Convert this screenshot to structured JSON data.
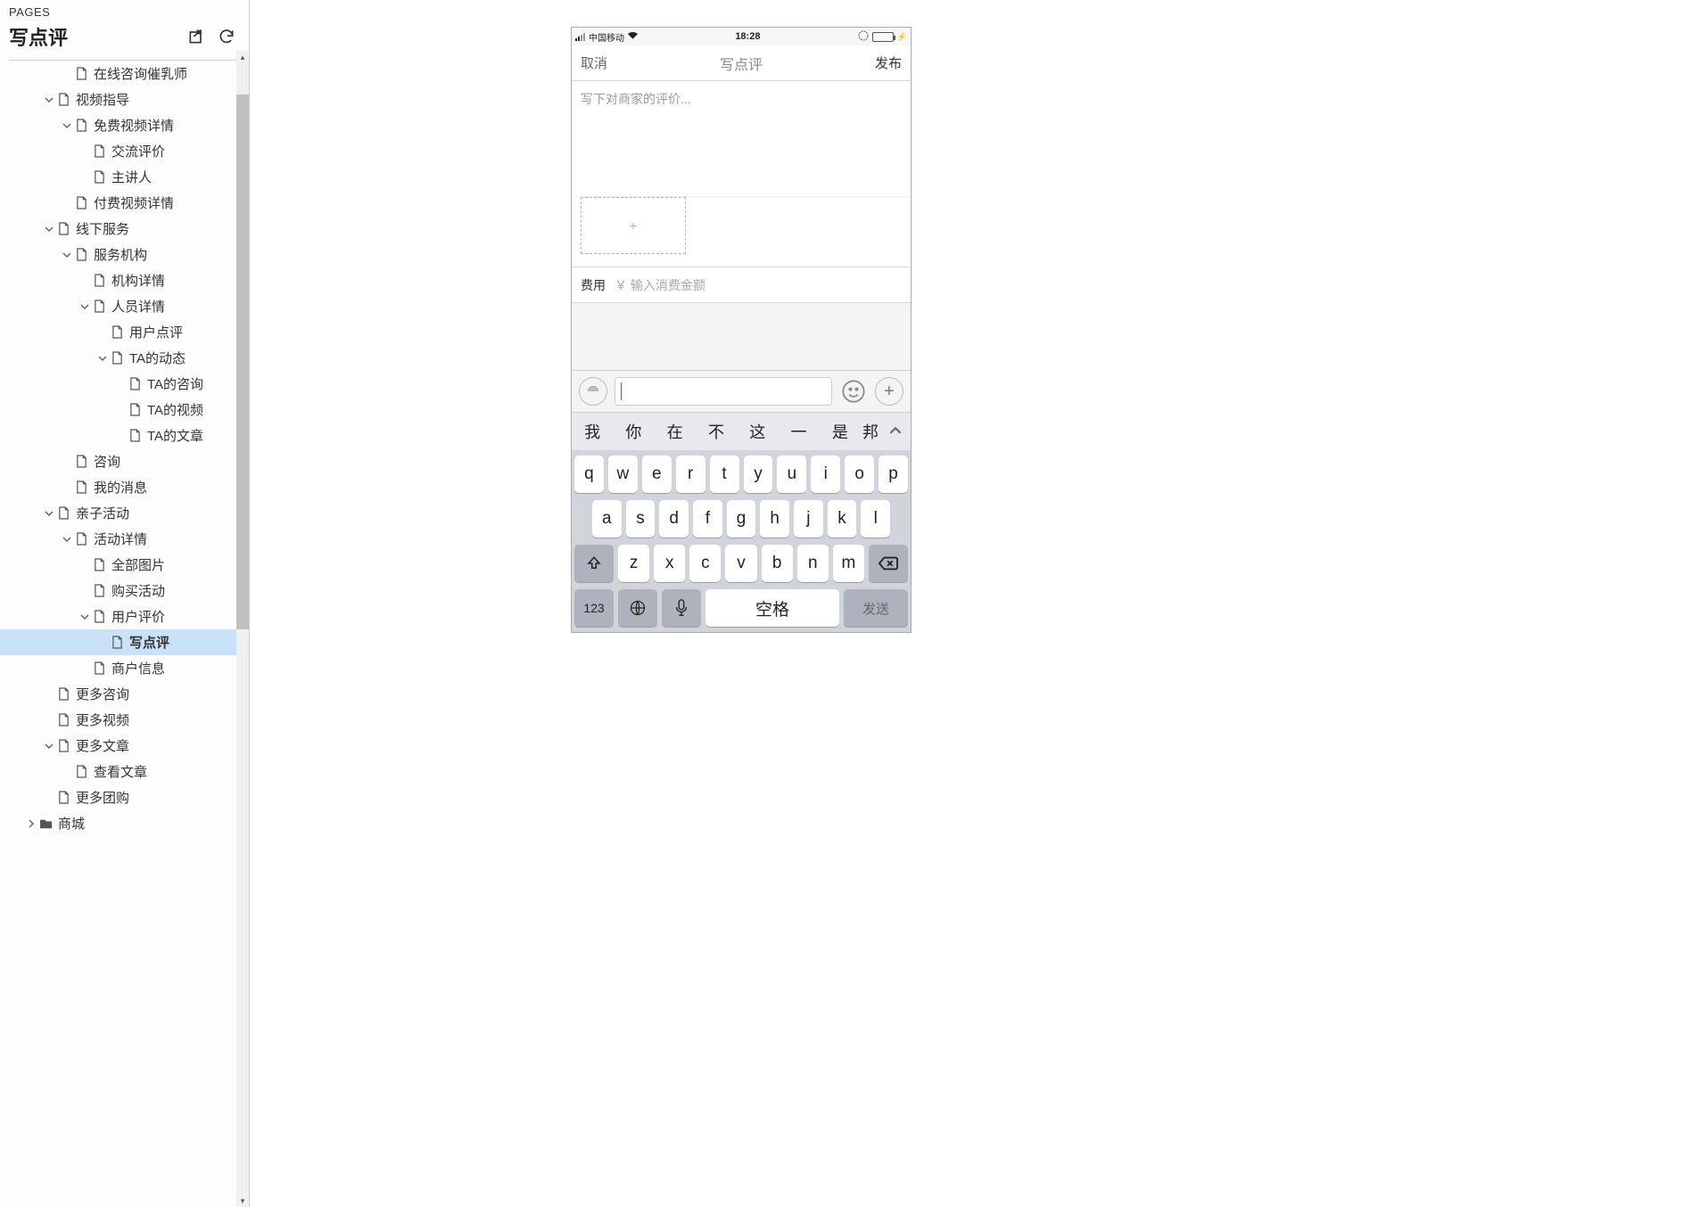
{
  "sidebar": {
    "pages_label": "PAGES",
    "current_page_title": "写点评",
    "tree": [
      {
        "depth": 3,
        "caret": "none",
        "icon": "doc",
        "label": "在线咨询催乳师"
      },
      {
        "depth": 2,
        "caret": "down",
        "icon": "doc",
        "label": "视频指导"
      },
      {
        "depth": 3,
        "caret": "down",
        "icon": "doc",
        "label": "免费视频详情"
      },
      {
        "depth": 4,
        "caret": "none",
        "icon": "doc",
        "label": "交流评价"
      },
      {
        "depth": 4,
        "caret": "none",
        "icon": "doc",
        "label": "主讲人"
      },
      {
        "depth": 3,
        "caret": "none",
        "icon": "doc",
        "label": "付费视频详情"
      },
      {
        "depth": 2,
        "caret": "down",
        "icon": "doc",
        "label": "线下服务"
      },
      {
        "depth": 3,
        "caret": "down",
        "icon": "doc",
        "label": "服务机构"
      },
      {
        "depth": 4,
        "caret": "none",
        "icon": "doc",
        "label": "机构详情"
      },
      {
        "depth": 4,
        "caret": "down",
        "icon": "doc",
        "label": "人员详情"
      },
      {
        "depth": 5,
        "caret": "none",
        "icon": "doc",
        "label": "用户点评"
      },
      {
        "depth": 5,
        "caret": "down",
        "icon": "doc",
        "label": "TA的动态"
      },
      {
        "depth": 6,
        "caret": "none",
        "icon": "doc",
        "label": "TA的咨询"
      },
      {
        "depth": 6,
        "caret": "none",
        "icon": "doc",
        "label": "TA的视频"
      },
      {
        "depth": 6,
        "caret": "none",
        "icon": "doc",
        "label": "TA的文章"
      },
      {
        "depth": 3,
        "caret": "none",
        "icon": "doc",
        "label": "咨询"
      },
      {
        "depth": 3,
        "caret": "none",
        "icon": "doc",
        "label": "我的消息"
      },
      {
        "depth": 2,
        "caret": "down",
        "icon": "doc",
        "label": "亲子活动"
      },
      {
        "depth": 3,
        "caret": "down",
        "icon": "doc",
        "label": "活动详情"
      },
      {
        "depth": 4,
        "caret": "none",
        "icon": "doc",
        "label": "全部图片"
      },
      {
        "depth": 4,
        "caret": "none",
        "icon": "doc",
        "label": "购买活动"
      },
      {
        "depth": 4,
        "caret": "down",
        "icon": "doc",
        "label": "用户评价"
      },
      {
        "depth": 5,
        "caret": "none",
        "icon": "doc",
        "label": "写点评",
        "selected": true
      },
      {
        "depth": 4,
        "caret": "none",
        "icon": "doc",
        "label": "商户信息"
      },
      {
        "depth": 2,
        "caret": "none",
        "icon": "doc",
        "label": "更多咨询"
      },
      {
        "depth": 2,
        "caret": "none",
        "icon": "doc",
        "label": "更多视频"
      },
      {
        "depth": 2,
        "caret": "down",
        "icon": "doc",
        "label": "更多文章"
      },
      {
        "depth": 3,
        "caret": "none",
        "icon": "doc",
        "label": "查看文章"
      },
      {
        "depth": 2,
        "caret": "none",
        "icon": "doc",
        "label": "更多团购"
      },
      {
        "depth": 1,
        "caret": "right",
        "icon": "folder",
        "label": "商城"
      }
    ]
  },
  "phone": {
    "status": {
      "carrier": "中国移动",
      "time": "18:28"
    },
    "nav": {
      "cancel": "取消",
      "title": "写点评",
      "publish": "发布"
    },
    "review_placeholder": "写下对商家的评价...",
    "photo_add_label": "+",
    "fee_label": "费用",
    "fee_placeholder": "￥ 输入消费金额",
    "predictions": [
      "我",
      "你",
      "在",
      "不",
      "这",
      "一",
      "是",
      "邦"
    ],
    "keyboard": {
      "row1": [
        "q",
        "w",
        "e",
        "r",
        "t",
        "y",
        "u",
        "i",
        "o",
        "p"
      ],
      "row2": [
        "a",
        "s",
        "d",
        "f",
        "g",
        "h",
        "j",
        "k",
        "l"
      ],
      "row3": [
        "z",
        "x",
        "c",
        "v",
        "b",
        "n",
        "m"
      ],
      "num_key": "123",
      "space_key": "空格",
      "send_key": "发送"
    }
  }
}
